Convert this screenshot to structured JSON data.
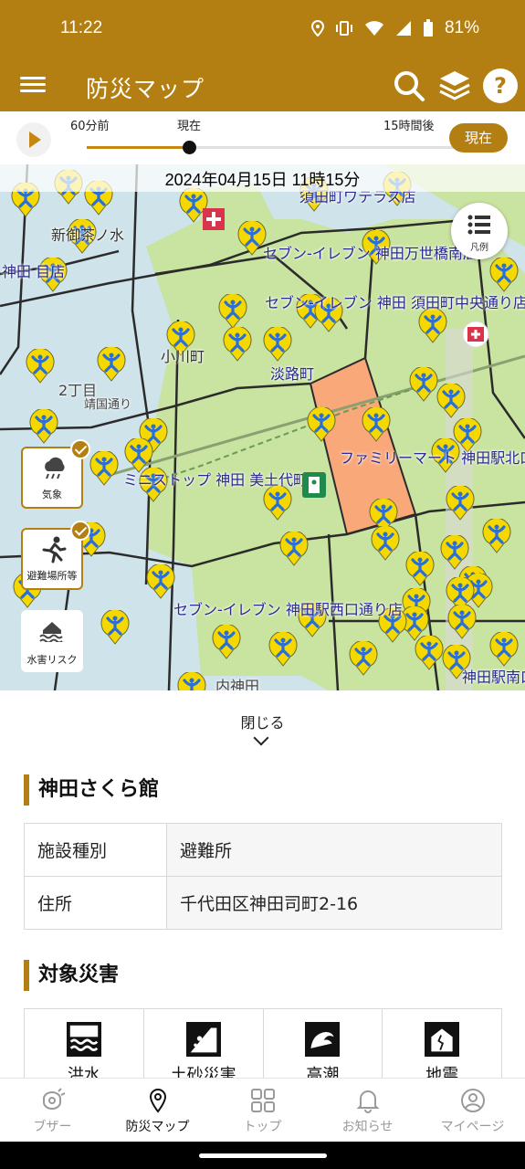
{
  "status_bar": {
    "time": "11:22",
    "battery": "81%"
  },
  "app_bar": {
    "title": "防災マップ"
  },
  "timeline": {
    "label_past": "60分前",
    "label_now": "現在",
    "label_future": "15時間後",
    "now_button": "現在"
  },
  "map": {
    "datetime": "2024年04月15日 11時15分",
    "legend_label": "凡例",
    "layers": [
      {
        "label": "気象",
        "active": true
      },
      {
        "label": "避難場所等",
        "active": true
      },
      {
        "label": "水害リスク",
        "active": false
      }
    ],
    "place_labels": [
      "セブン-イレブン 神田万世橋南店",
      "セブン-イレブン 神田 須田町中央通り店",
      "ファミリーマート 神田駅北口店",
      "ミニストップ 神田 美土代町店",
      "セブン-イレブン 神田駅西口通り店",
      "小川町",
      "淡路町",
      "内神田",
      "2丁目",
      "靖国通り",
      "神田駅南口",
      "新御茶ノ水",
      "神田 目店",
      "須田町ワテラス店"
    ]
  },
  "sheet": {
    "close_label": "閉じる",
    "facility_name": "神田さくら館",
    "info_rows": [
      {
        "key": "施設種別",
        "value": "避難所"
      },
      {
        "key": "住所",
        "value": "千代田区神田司町2-16"
      }
    ],
    "hazards_title": "対象災害",
    "hazards": [
      {
        "label": "洪水",
        "icon": "flood-icon"
      },
      {
        "label": "土砂災害",
        "icon": "landslide-icon"
      },
      {
        "label": "高潮",
        "icon": "storm-surge-icon"
      },
      {
        "label": "地震",
        "icon": "earthquake-icon"
      }
    ]
  },
  "bottom_nav": [
    {
      "label": "ブザー",
      "icon": "buzzer-icon",
      "active": false
    },
    {
      "label": "防災マップ",
      "icon": "map-pin-icon",
      "active": true
    },
    {
      "label": "トップ",
      "icon": "grid-icon",
      "active": false
    },
    {
      "label": "お知らせ",
      "icon": "bell-icon",
      "active": false
    },
    {
      "label": "マイページ",
      "icon": "user-icon",
      "active": false
    }
  ],
  "colors": {
    "brand": "#b47f12",
    "map_highlight": "#f9a87a",
    "map_area": "#c9e3a0",
    "shelter_pin": "#f5d800",
    "shelter_figure": "#2a6fd6"
  }
}
